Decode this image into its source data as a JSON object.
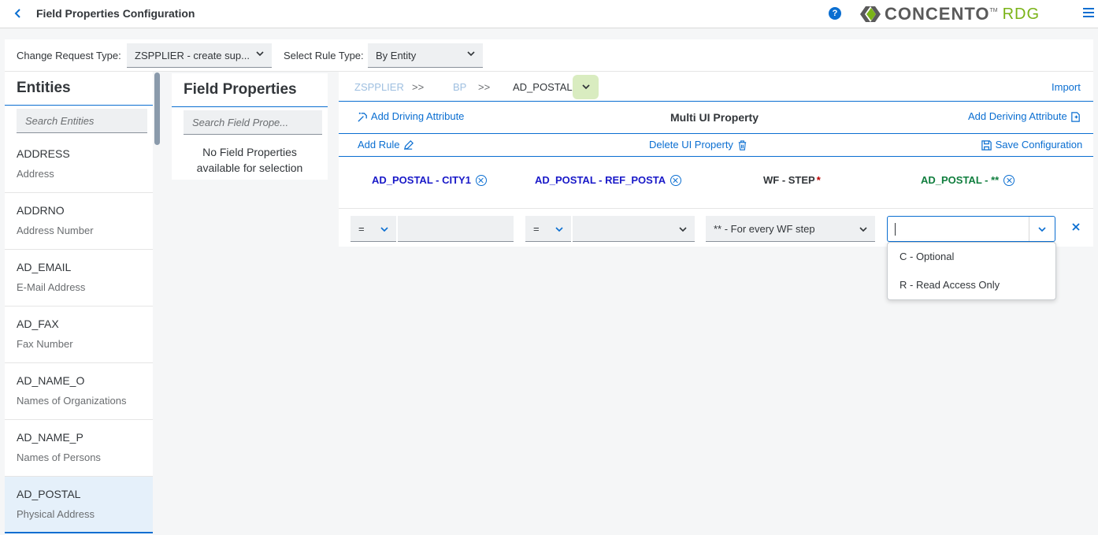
{
  "header": {
    "title": "Field Properties Configuration",
    "help_glyph": "?",
    "logo_word": "CONCENTO",
    "logo_tm": "TM",
    "logo_suffix": "RDG"
  },
  "filters": {
    "change_request_label": "Change Request Type:",
    "change_request_value": "ZSPPLIER - create sup...",
    "rule_type_label": "Select Rule Type:",
    "rule_type_value": "By Entity"
  },
  "entities": {
    "title": "Entities",
    "search_placeholder": "Search Entities",
    "items": [
      {
        "code": "ADDRESS",
        "desc": "Address"
      },
      {
        "code": "ADDRNO",
        "desc": "Address Number"
      },
      {
        "code": "AD_EMAIL",
        "desc": "E-Mail Address"
      },
      {
        "code": "AD_FAX",
        "desc": "Fax Number"
      },
      {
        "code": "AD_NAME_O",
        "desc": "Names of Organizations"
      },
      {
        "code": "AD_NAME_P",
        "desc": "Names of Persons"
      },
      {
        "code": "AD_POSTAL",
        "desc": "Physical Address"
      }
    ],
    "selected_index": 6
  },
  "field_properties": {
    "title": "Field Properties",
    "search_placeholder": "Search Field Prope...",
    "empty_line1": "No Field Properties",
    "empty_line2": "available for selection"
  },
  "breadcrumb": {
    "items": [
      "ZSPPLIER",
      "BP",
      "AD_POSTAL"
    ],
    "separator": ">>",
    "import_label": "Import"
  },
  "toolbar": {
    "add_driving": "Add Driving Attribute",
    "title": "Multi UI Property",
    "add_deriving": "Add Deriving Attribute",
    "add_rule": "Add Rule",
    "delete_ui": "Delete UI Property",
    "save_config": "Save Configuration"
  },
  "columns": [
    {
      "label": "AD_POSTAL - CITY1",
      "color": "#1919c8"
    },
    {
      "label": "AD_POSTAL - REF_POSTA",
      "color": "#1919c8"
    },
    {
      "label": "WF - STEP",
      "required_mark": "*",
      "color": "#32363a"
    },
    {
      "label": "AD_POSTAL - **",
      "color": "#107e3e"
    }
  ],
  "rule_row": {
    "op1": "=",
    "op2": "=",
    "wf_step": "** - For every WF step",
    "property_value": ""
  },
  "dropdown_options": [
    "C - Optional",
    "R - Read Access Only"
  ],
  "colors": {
    "accent": "#0a6ed1",
    "logo_green": "#7ab317",
    "selected_bg": "#e5f0fa"
  }
}
